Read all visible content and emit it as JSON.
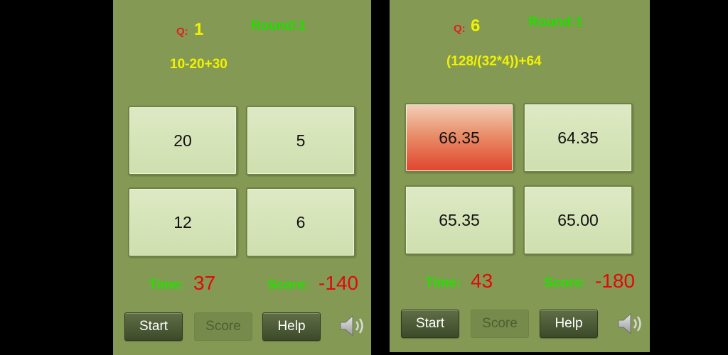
{
  "screens": [
    {
      "question_label": "Q:",
      "question_number": "1",
      "round_label": "Round:1",
      "expression": "10-20+30",
      "answers": [
        "20",
        "5",
        "12",
        "6"
      ],
      "time_label": "Time:",
      "time_value": "37",
      "score_label": "Score:",
      "score_value": "-140",
      "controls": {
        "start": "Start",
        "score": "Score",
        "help": "Help"
      },
      "sound_icon": "speaker-icon"
    },
    {
      "question_label": "Q:",
      "question_number": "6",
      "round_label": "Round:1",
      "expression": "(128/(32*4))+64",
      "answers": [
        "66.35",
        "64.35",
        "65.35",
        "65.00"
      ],
      "selected_wrong_answer": "66.35",
      "time_label": "Time:",
      "time_value": "43",
      "score_label": "Score:",
      "score_value": "-180",
      "controls": {
        "start": "Start",
        "score": "Score",
        "help": "Help"
      },
      "sound_icon": "speaker-icon"
    }
  ],
  "colors": {
    "background": "#849a54",
    "answer_button": "#d8e6bf",
    "wrong_answer": "#e0452c",
    "label_green": "#22e000",
    "value_red": "#e00a0a",
    "question_yellow": "#f2f200"
  }
}
